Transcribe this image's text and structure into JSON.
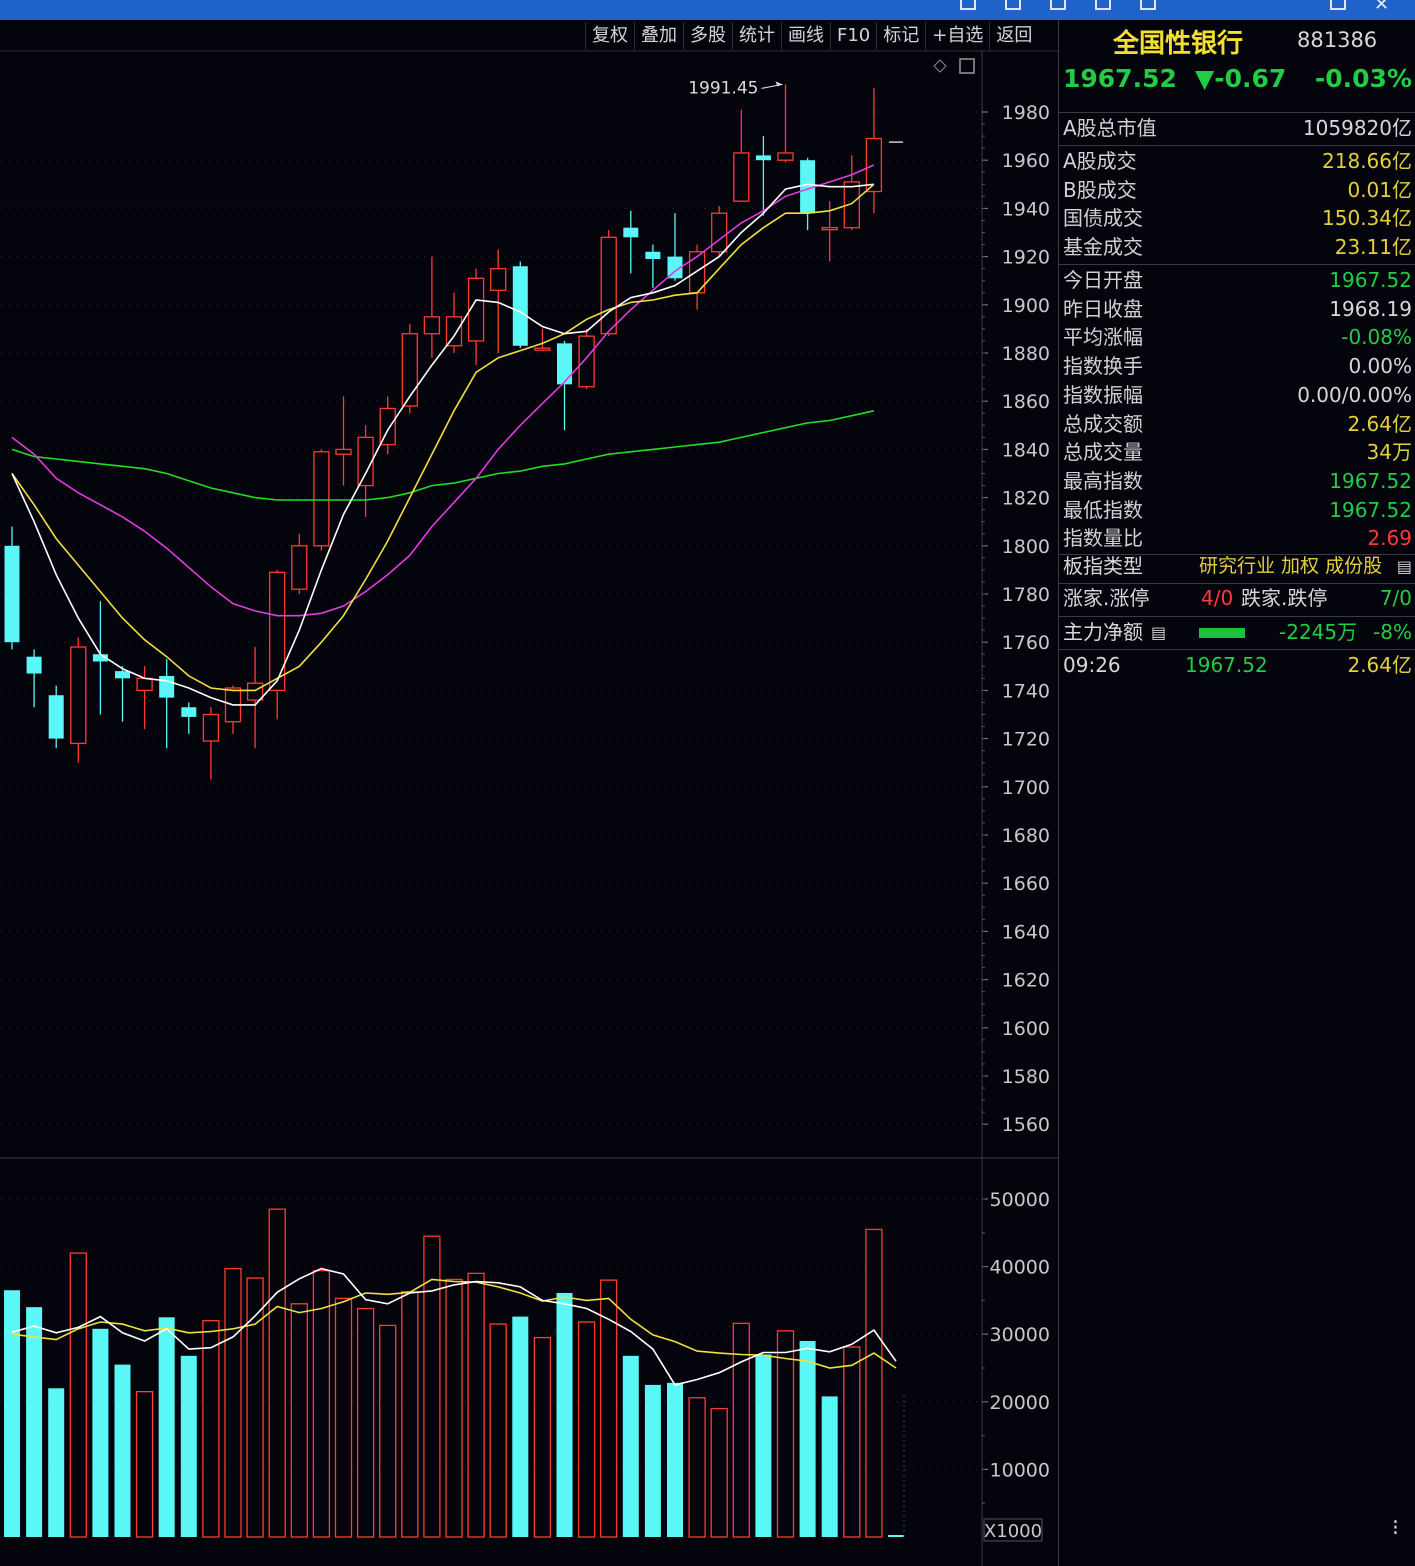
{
  "toolbar": [
    "复权",
    "叠加",
    "多股",
    "统计",
    "画线",
    "F10",
    "标记",
    "+自选",
    "返回"
  ],
  "price_chart": {
    "peak_label": "1991.45",
    "y_ticks": [
      1980,
      1960,
      1940,
      1920,
      1900,
      1880,
      1860,
      1840,
      1820,
      1800,
      1780,
      1760,
      1740,
      1720,
      1700,
      1680,
      1660,
      1640,
      1620,
      1600,
      1580,
      1560
    ],
    "ylim": [
      1550,
      2000
    ]
  },
  "chart_data": [
    {
      "type": "candlestick",
      "ylim": [
        1550,
        2000
      ],
      "candles": [
        {
          "o": 1800,
          "c": 1760,
          "h": 1808,
          "l": 1757
        },
        {
          "o": 1754,
          "c": 1747,
          "h": 1757,
          "l": 1733
        },
        {
          "o": 1738,
          "c": 1720,
          "h": 1742,
          "l": 1716
        },
        {
          "o": 1718,
          "c": 1758,
          "h": 1762,
          "l": 1710
        },
        {
          "o": 1755,
          "c": 1752,
          "h": 1777,
          "l": 1730
        },
        {
          "o": 1748,
          "c": 1745,
          "h": 1750,
          "l": 1727
        },
        {
          "o": 1740,
          "c": 1745,
          "h": 1750,
          "l": 1724
        },
        {
          "o": 1746,
          "c": 1737,
          "h": 1753,
          "l": 1716
        },
        {
          "o": 1733,
          "c": 1729,
          "h": 1735,
          "l": 1722
        },
        {
          "o": 1719,
          "c": 1730,
          "h": 1733,
          "l": 1703
        },
        {
          "o": 1727,
          "c": 1741,
          "h": 1742,
          "l": 1722
        },
        {
          "o": 1736,
          "c": 1743,
          "h": 1758,
          "l": 1716
        },
        {
          "o": 1740,
          "c": 1789,
          "h": 1790,
          "l": 1728
        },
        {
          "o": 1782,
          "c": 1800,
          "h": 1805,
          "l": 1780
        },
        {
          "o": 1800,
          "c": 1839,
          "h": 1840,
          "l": 1798
        },
        {
          "o": 1838,
          "c": 1840,
          "h": 1862,
          "l": 1825
        },
        {
          "o": 1825,
          "c": 1845,
          "h": 1850,
          "l": 1812
        },
        {
          "o": 1842,
          "c": 1857,
          "h": 1862,
          "l": 1838
        },
        {
          "o": 1858,
          "c": 1888,
          "h": 1892,
          "l": 1855
        },
        {
          "o": 1888,
          "c": 1895,
          "h": 1920,
          "l": 1878
        },
        {
          "o": 1883,
          "c": 1895,
          "h": 1905,
          "l": 1880
        },
        {
          "o": 1885,
          "c": 1911,
          "h": 1915,
          "l": 1875
        },
        {
          "o": 1906,
          "c": 1915,
          "h": 1923,
          "l": 1880
        },
        {
          "o": 1916,
          "c": 1883,
          "h": 1918,
          "l": 1882
        },
        {
          "o": 1882,
          "c": 1882,
          "h": 1890,
          "l": 1882
        },
        {
          "o": 1884,
          "c": 1867,
          "h": 1885,
          "l": 1848
        },
        {
          "o": 1866,
          "c": 1887,
          "h": 1890,
          "l": 1865
        },
        {
          "o": 1888,
          "c": 1928,
          "h": 1931,
          "l": 1887
        },
        {
          "o": 1932,
          "c": 1928,
          "h": 1939,
          "l": 1913
        },
        {
          "o": 1922,
          "c": 1919,
          "h": 1925,
          "l": 1907
        },
        {
          "o": 1920,
          "c": 1911,
          "h": 1938,
          "l": 1910
        },
        {
          "o": 1905,
          "c": 1922,
          "h": 1925,
          "l": 1898
        },
        {
          "o": 1922,
          "c": 1938,
          "h": 1941,
          "l": 1920
        },
        {
          "o": 1943,
          "c": 1963,
          "h": 1981,
          "l": 1943
        },
        {
          "o": 1962,
          "c": 1960,
          "h": 1970,
          "l": 1937
        },
        {
          "o": 1960,
          "c": 1963,
          "h": 1991.45,
          "l": 1959
        },
        {
          "o": 1960,
          "c": 1938,
          "h": 1961,
          "l": 1931
        },
        {
          "o": 1932,
          "c": 1932,
          "h": 1943,
          "l": 1918
        },
        {
          "o": 1932,
          "c": 1951,
          "h": 1962,
          "l": 1931
        },
        {
          "o": 1947,
          "c": 1969,
          "h": 1990,
          "l": 1938
        },
        {
          "o": 1967.52,
          "c": 1967.52,
          "h": 1967.52,
          "l": 1967.52
        }
      ],
      "ma_white": [
        1830,
        1810,
        1788,
        1770,
        1755,
        1749,
        1745,
        1744,
        1741,
        1737,
        1734,
        1734,
        1744,
        1765,
        1790,
        1813,
        1830,
        1848,
        1862,
        1875,
        1887,
        1902,
        1901,
        1897,
        1891,
        1888,
        1889,
        1897,
        1903,
        1905,
        1908,
        1914,
        1920,
        1930,
        1938,
        1948,
        1950,
        1949,
        1949,
        1950
      ],
      "ma_yellow": [
        1830,
        1817,
        1803,
        1792,
        1781,
        1770,
        1761,
        1754,
        1746,
        1741,
        1740,
        1740,
        1745,
        1750,
        1760,
        1771,
        1786,
        1802,
        1820,
        1838,
        1856,
        1872,
        1878,
        1881,
        1884,
        1888,
        1894,
        1898,
        1901,
        1902,
        1904,
        1905,
        1915,
        1925,
        1932,
        1938,
        1938,
        1939,
        1942,
        1950
      ],
      "ma_magenta": [
        1845,
        1838,
        1828,
        1822,
        1817,
        1812,
        1806,
        1799,
        1791,
        1783,
        1776,
        1773,
        1771,
        1771,
        1772,
        1775,
        1781,
        1788,
        1796,
        1808,
        1818,
        1828,
        1840,
        1850,
        1859,
        1868,
        1878,
        1889,
        1898,
        1906,
        1914,
        1920,
        1927,
        1934,
        1939,
        1945,
        1948,
        1951,
        1954,
        1958
      ],
      "ma_green": [
        1840,
        1837,
        1836,
        1835,
        1834,
        1833,
        1832,
        1830,
        1827,
        1824,
        1822,
        1820,
        1819,
        1819,
        1819,
        1819,
        1819,
        1820,
        1822,
        1825,
        1826,
        1828,
        1830,
        1831,
        1833,
        1834,
        1836,
        1838,
        1839,
        1840,
        1841,
        1842,
        1843,
        1845,
        1847,
        1849,
        1851,
        1852,
        1854,
        1856
      ]
    },
    {
      "type": "bar",
      "multiplier_label": "X1000",
      "y_ticks": [
        50000,
        40000,
        30000,
        20000,
        10000
      ],
      "ylim": [
        0,
        52000
      ],
      "bars": [
        {
          "v": 36500,
          "up": false
        },
        {
          "v": 34000,
          "up": false
        },
        {
          "v": 22000,
          "up": false
        },
        {
          "v": 42000,
          "up": true
        },
        {
          "v": 30800,
          "up": false
        },
        {
          "v": 25500,
          "up": false
        },
        {
          "v": 21500,
          "up": true
        },
        {
          "v": 32500,
          "up": false
        },
        {
          "v": 26800,
          "up": false
        },
        {
          "v": 32000,
          "up": true
        },
        {
          "v": 39700,
          "up": true
        },
        {
          "v": 38300,
          "up": true
        },
        {
          "v": 48500,
          "up": true
        },
        {
          "v": 34500,
          "up": true
        },
        {
          "v": 39400,
          "up": true
        },
        {
          "v": 35300,
          "up": true
        },
        {
          "v": 33800,
          "up": true
        },
        {
          "v": 31300,
          "up": true
        },
        {
          "v": 36300,
          "up": true
        },
        {
          "v": 44500,
          "up": true
        },
        {
          "v": 38100,
          "up": true
        },
        {
          "v": 39000,
          "up": true
        },
        {
          "v": 31500,
          "up": true
        },
        {
          "v": 32600,
          "up": false
        },
        {
          "v": 29500,
          "up": true
        },
        {
          "v": 36100,
          "up": false
        },
        {
          "v": 31800,
          "up": true
        },
        {
          "v": 38000,
          "up": true
        },
        {
          "v": 26800,
          "up": false
        },
        {
          "v": 22500,
          "up": false
        },
        {
          "v": 22800,
          "up": false
        },
        {
          "v": 20600,
          "up": true
        },
        {
          "v": 19000,
          "up": true
        },
        {
          "v": 31600,
          "up": true
        },
        {
          "v": 27000,
          "up": false
        },
        {
          "v": 30500,
          "up": true
        },
        {
          "v": 29000,
          "up": false
        },
        {
          "v": 20800,
          "up": false
        },
        {
          "v": 28100,
          "up": true
        },
        {
          "v": 45500,
          "up": true
        },
        {
          "v": 400,
          "up": false
        }
      ],
      "ma_white": [
        30300,
        31200,
        30200,
        31000,
        32600,
        30200,
        29000,
        30800,
        27800,
        28000,
        29600,
        32700,
        36200,
        38200,
        39700,
        38900,
        35100,
        34500,
        36100,
        36400,
        37300,
        37800,
        37600,
        37000,
        35000,
        34500,
        33800,
        32200,
        30400,
        27800,
        22500,
        23300,
        24300,
        25900,
        27300,
        27300,
        27900,
        27400,
        28500,
        30600,
        26000
      ],
      "ma_yellow": [
        30000,
        29600,
        29200,
        30800,
        31800,
        31500,
        30500,
        30900,
        30200,
        30400,
        30800,
        31500,
        34100,
        33200,
        33800,
        34800,
        36100,
        35900,
        36200,
        38100,
        37800,
        37700,
        37000,
        36100,
        34900,
        35500,
        35000,
        35300,
        32200,
        29900,
        28900,
        27500,
        27200,
        27000,
        26900,
        26400,
        26000,
        25000,
        25400,
        27200,
        25000
      ]
    }
  ],
  "panel": {
    "name": "全国性银行",
    "code": "881386",
    "price": "1967.52",
    "change": "▼-0.67",
    "change_pct": "-0.03%",
    "rows1": [
      {
        "label": "A股总市值",
        "value": "1059820亿",
        "color": "white"
      }
    ],
    "rows2": [
      {
        "label": "A股成交",
        "value": "218.66亿",
        "color": "yellow"
      },
      {
        "label": "B股成交",
        "value": "0.01亿",
        "color": "yellow"
      },
      {
        "label": "国债成交",
        "value": "150.34亿",
        "color": "yellow"
      },
      {
        "label": "基金成交",
        "value": "23.11亿",
        "color": "yellow"
      }
    ],
    "rows3": [
      {
        "label": "今日开盘",
        "value": "1967.52",
        "color": "green"
      },
      {
        "label": "昨日收盘",
        "value": "1968.19",
        "color": "white"
      },
      {
        "label": "平均涨幅",
        "value": "-0.08%",
        "color": "green"
      },
      {
        "label": "指数换手",
        "value": "0.00%",
        "color": "white"
      },
      {
        "label": "指数振幅",
        "value": "0.00/0.00%",
        "color": "white"
      },
      {
        "label": "总成交额",
        "value": "2.64亿",
        "color": "yellow"
      },
      {
        "label": "总成交量",
        "value": "34万",
        "color": "yellow"
      },
      {
        "label": "最高指数",
        "value": "1967.52",
        "color": "green"
      },
      {
        "label": "最低指数",
        "value": "1967.52",
        "color": "green"
      },
      {
        "label": "指数量比",
        "value": "2.69",
        "color": "red"
      }
    ],
    "type_label": "板指类型",
    "type_value": "研究行业 加权 成份股",
    "limit_up_label": "涨家.涨停",
    "limit_up_value": "4/0",
    "limit_down_label": "跌家.跌停",
    "limit_down_value": "7/0",
    "main_flow_label": "主力净额",
    "main_flow_value": "-2245万",
    "main_flow_pct": "-8%",
    "tick_time": "09:26",
    "tick_price": "1967.52",
    "tick_amount": "2.64亿"
  }
}
